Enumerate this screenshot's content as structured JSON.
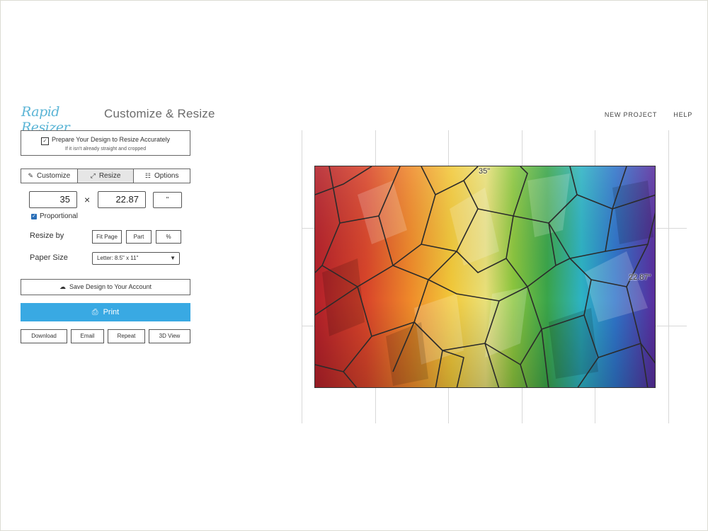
{
  "header": {
    "logo_text": "Rapid Resizer",
    "title": "Customize & Resize",
    "links": [
      "NEW PROJECT",
      "HELP"
    ]
  },
  "prepare": {
    "line1": "Prepare Your Design to Resize Accurately",
    "line2": "If it isn't already straight and cropped"
  },
  "tabs": [
    {
      "label": "Customize",
      "icon": "pencil-icon"
    },
    {
      "label": "Resize",
      "icon": "resize-arrows-icon"
    },
    {
      "label": "Options",
      "icon": "sliders-icon"
    }
  ],
  "size": {
    "width": "35",
    "height": "22.87",
    "times": "×",
    "unit": "\"",
    "proportional_label": "Proportional"
  },
  "resize_by": {
    "label": "Resize by",
    "options": [
      "Fit Page",
      "Part",
      "%"
    ]
  },
  "paper_size": {
    "label": "Paper Size",
    "selected": "Letter: 8.5\" x 11\""
  },
  "actions": {
    "save_label": "Save Design to Your Account",
    "print_label": "Print",
    "download": "Download",
    "email": "Email",
    "repeat": "Repeat",
    "view3d": "3D View"
  },
  "canvas": {
    "width_label": "35\"",
    "height_label": "22.87\""
  },
  "colors": {
    "accent": "#39a9e3",
    "logo": "#5bb5d6"
  }
}
